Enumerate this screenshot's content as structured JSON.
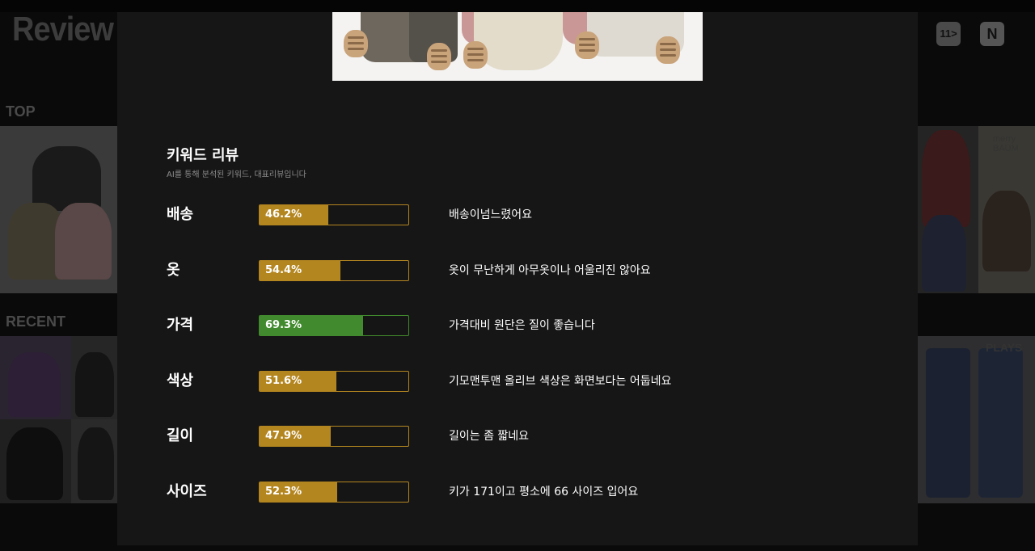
{
  "background": {
    "logo_text": "Review F",
    "stores": [
      "11>",
      "N"
    ],
    "sections": {
      "top_label": "TOP",
      "recent_label": "RECENT"
    },
    "watermarks": [
      "merry BAUM",
      "PLAYS"
    ]
  },
  "keyword_review": {
    "title": "키워드 리뷰",
    "subtitle": "AI를 통해 분석된 키워드, 대표리뷰입니다",
    "items": [
      {
        "keyword": "배송",
        "percent_label": "46.2%",
        "percent": 46.2,
        "review": "배송이넘느렸어요",
        "status": "warn"
      },
      {
        "keyword": "옷",
        "percent_label": "54.4%",
        "percent": 54.4,
        "review": "옷이 무난하게 아무옷이나 어울리진 않아요",
        "status": "warn"
      },
      {
        "keyword": "가격",
        "percent_label": "69.3%",
        "percent": 69.3,
        "review": "가격대비 원단은 질이 좋습니다",
        "status": "good"
      },
      {
        "keyword": "색상",
        "percent_label": "51.6%",
        "percent": 51.6,
        "review": "기모맨투맨 올리브 색상은 화면보다는 어둡네요",
        "status": "warn"
      },
      {
        "keyword": "길이",
        "percent_label": "47.9%",
        "percent": 47.9,
        "review": "길이는 좀 짧네요",
        "status": "warn"
      },
      {
        "keyword": "사이즈",
        "percent_label": "52.3%",
        "percent": 52.3,
        "review": "키가 171이고 평소에 66 사이즈 입어요",
        "status": "warn"
      }
    ]
  },
  "colors": {
    "warn": "#b48620",
    "good": "#418a2d",
    "modal_bg": "#161616"
  }
}
